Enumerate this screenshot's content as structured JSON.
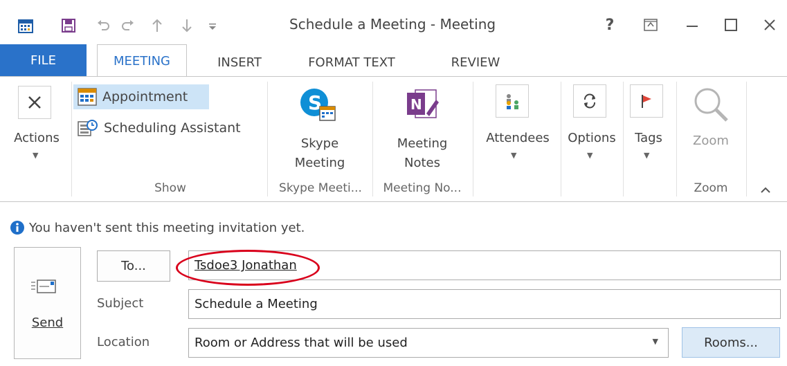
{
  "window": {
    "title": "Schedule a Meeting - Meeting"
  },
  "title_bar_controls": {
    "help": "?",
    "ribbon_display": "ribbon-display-options-icon",
    "minimize": "minimize-icon",
    "maximize": "maximize-icon",
    "close": "close-icon"
  },
  "quick_access": {
    "items": [
      "outlook-calendar-icon",
      "save-icon",
      "undo-icon",
      "redo-icon",
      "previous-item-icon",
      "next-item-icon",
      "customize-qat-icon"
    ]
  },
  "tabs": [
    {
      "label": "FILE"
    },
    {
      "label": "MEETING",
      "active": true
    },
    {
      "label": "INSERT"
    },
    {
      "label": "FORMAT TEXT"
    },
    {
      "label": "REVIEW"
    }
  ],
  "ribbon": {
    "actions": {
      "label": "Actions"
    },
    "show": {
      "appointment": "Appointment",
      "scheduling_assistant": "Scheduling Assistant",
      "group": "Show"
    },
    "skype": {
      "line1": "Skype",
      "line2": "Meeting",
      "group": "Skype Meeti..."
    },
    "notes": {
      "line1": "Meeting",
      "line2": "Notes",
      "group": "Meeting No..."
    },
    "attendees": {
      "label": "Attendees"
    },
    "options": {
      "label": "Options"
    },
    "tags": {
      "label": "Tags"
    },
    "zoom": {
      "label": "Zoom",
      "group": "Zoom"
    }
  },
  "infobar": {
    "text": "You haven't sent this meeting invitation yet."
  },
  "form": {
    "send_label": "Send",
    "to_button": "To...",
    "to_value": "Tsdoe3 Jonathan",
    "subject_label": "Subject",
    "subject_value": "Schedule a Meeting",
    "location_label": "Location",
    "location_value": "Room or Address that will be used",
    "rooms_button": "Rooms..."
  },
  "colors": {
    "accent": "#2a72c9",
    "file_tab": "#2a72c9",
    "selected": "#cde4f7",
    "annotation": "#d9001b"
  }
}
